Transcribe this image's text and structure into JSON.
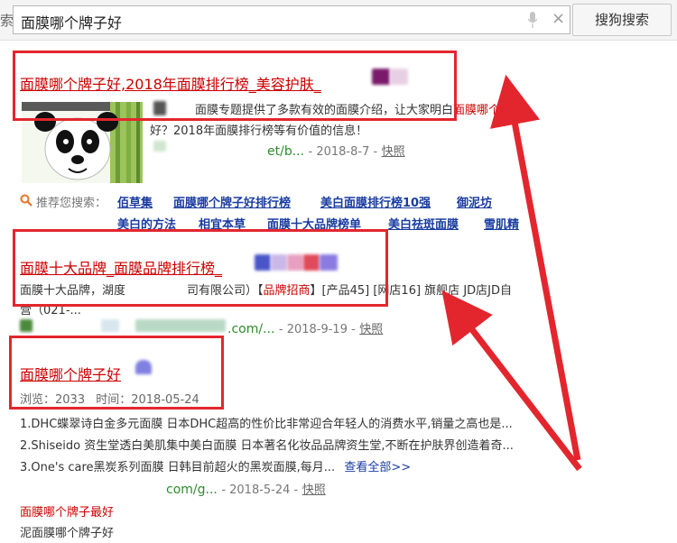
{
  "search": {
    "left_glyph": "索",
    "query": "面膜哪个牌子好",
    "mic_icon": "microphone-icon",
    "clear_icon": "close-icon",
    "clear_glyph": "×",
    "button_label": "搜狗搜索"
  },
  "results": [
    {
      "title": "面膜哪个牌子好,2018年面膜排行榜_美容护肤_",
      "desc_line1_pre": "面膜专题提供了多款有效的面膜介绍，让大家明白",
      "desc_line1_hl": "面膜哪个牌子",
      "desc_line2": "好？2018年面膜排行榜等有价值的信息！",
      "url": "et/b...",
      "date": "- 2018-8-7 -",
      "snapshot": "快照"
    },
    {
      "title": "面膜十大品牌_面膜品牌排行榜_",
      "desc_pre": "面膜十大品牌，湖度",
      "desc_mid": "司有限公司）【",
      "desc_hl": "品牌招商",
      "desc_post": "】[产品45] [网店16] 旗舰店 JD店JD自",
      "desc_line2": "营（021-...",
      "url": ".com/...",
      "date": "- 2018-9-19 -",
      "snapshot": "快照"
    },
    {
      "title": "面膜哪个牌子好",
      "views_label": "浏览：2033",
      "time_label": "时间：2018-05-24",
      "items": [
        "1.DHC蝶翠诗白金多元面膜 日本DHC超高的性价比非常迎合年轻人的消费水平,销量之高也是...",
        "2.Shiseido 资生堂透白美肌集中美白面膜 日本著名化妆品品牌资生堂,不断在护肤界创造着奇...",
        "3.One's care黑炭系列面膜 日韩目前超火的黑炭面膜,每月..."
      ],
      "more": "查看全部>>",
      "url": "com/g...",
      "date": "- 2018-5-24 -",
      "snapshot": "快照"
    }
  ],
  "recommend": {
    "icon": "search-icon",
    "label": "推荐您搜索：",
    "row1": [
      "佰草集",
      "面膜哪个牌子好排行榜",
      "美白面膜排行榜10强",
      "御泥坊"
    ],
    "row2": [
      "美白的方法",
      "相宜本草",
      "面膜十大品牌榜单",
      "美白祛斑面膜",
      "雪肌精"
    ]
  },
  "footer": [
    "面膜哪个牌子最好",
    "泥面膜哪个牌子好"
  ],
  "colors": {
    "annotation": "#e3262e",
    "result_title": "#cc0000",
    "url": "#2e8b2e",
    "rec_link": "#1a3ca0"
  }
}
